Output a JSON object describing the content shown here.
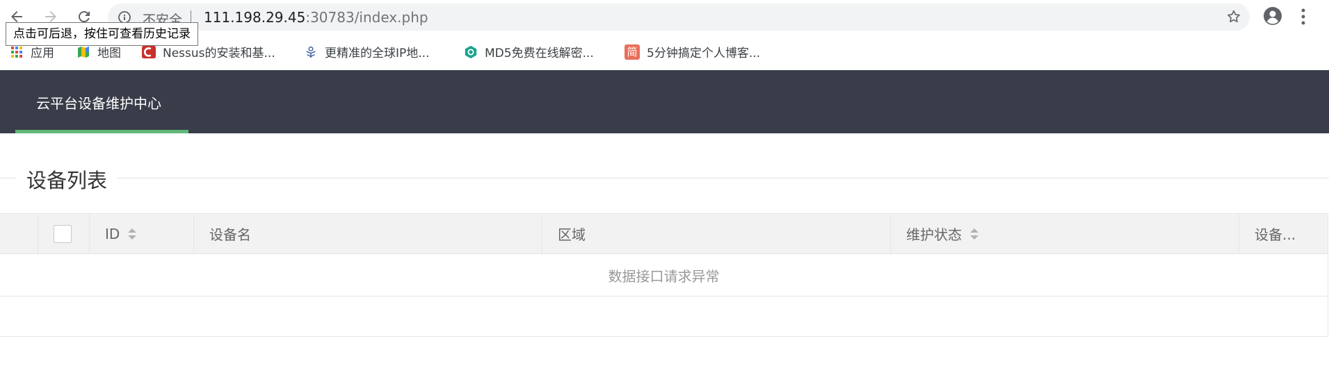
{
  "browser": {
    "insecure_label": "不安全",
    "url_host": "111.198.29.45",
    "url_rest": ":30783/index.php",
    "tooltip": "点击可后退，按住可查看历史记录",
    "icons": [
      "back-arrow-icon",
      "forward-arrow-icon",
      "reload-icon",
      "info-icon",
      "star-icon",
      "profile-icon",
      "more-menu-icon"
    ]
  },
  "bookmarks": [
    {
      "label": "应用",
      "icon": "apps-grid-icon"
    },
    {
      "label": "地图",
      "icon": "maps-icon"
    },
    {
      "label": "Nessus的安装和基...",
      "icon": "nessus-icon"
    },
    {
      "label": "更精准的全球IP地...",
      "icon": "ip-location-icon"
    },
    {
      "label": "MD5免费在线解密...",
      "icon": "md5-icon"
    },
    {
      "label": "5分钟搞定个人博客...",
      "icon": "jianshu-icon",
      "icon_text": "简"
    }
  ],
  "app": {
    "brand": "云平台设备维护中心",
    "section_title": "设备列表",
    "accent_color": "#5fb878",
    "header_color": "#393d49"
  },
  "table": {
    "columns": [
      {
        "label": ""
      },
      {
        "label": ""
      },
      {
        "label": "ID",
        "sortable": true
      },
      {
        "label": "设备名"
      },
      {
        "label": "区域"
      },
      {
        "label": "维护状态",
        "sortable": true
      },
      {
        "label": "设备..."
      }
    ],
    "empty_message": "数据接口请求异常"
  }
}
